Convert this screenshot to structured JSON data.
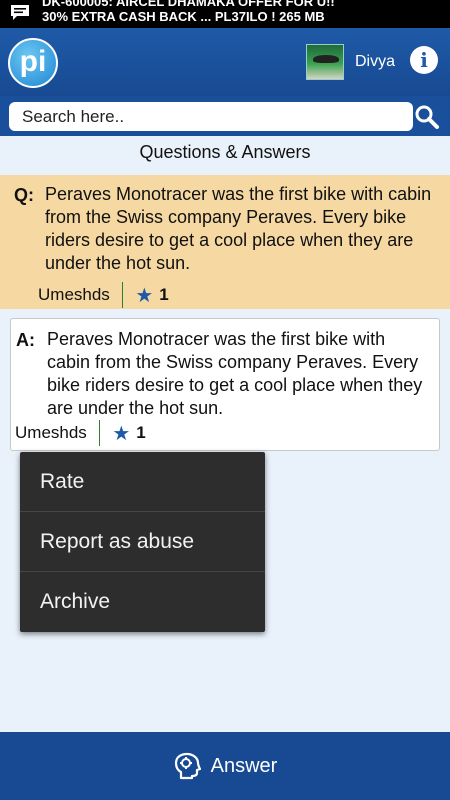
{
  "status_bar": {
    "ticker_line1": "DK-600005: AIRCEL DHAMAKA OFFER FOR U!!",
    "ticker_line2": "30% EXTRA CASH BACK ... PL37ILO ! 265 MB"
  },
  "header": {
    "logo_text": "pi",
    "username": "Divya",
    "info_glyph": "i"
  },
  "search": {
    "placeholder": "Search here.."
  },
  "section_title": "Questions & Answers",
  "question": {
    "prefix": "Q:",
    "text": "Peraves Monotracer was the first bike with cabin from the Swiss company Peraves. Every bike riders desire to get a cool place when they are under the hot sun.",
    "author": "Umeshds",
    "rating": "1"
  },
  "answer": {
    "prefix": "A:",
    "text": "Peraves Monotracer was the first bike with cabin from the Swiss company Peraves. Every bike riders desire to get a cool place when they are under the hot sun.",
    "author": "Umeshds",
    "rating": "1"
  },
  "context_menu": {
    "items": [
      "Rate",
      "Report as abuse",
      "Archive"
    ]
  },
  "bottom_bar": {
    "answer_label": "Answer"
  },
  "icons": {
    "message": "message-icon",
    "search": "search-icon",
    "info": "info-icon",
    "star": "star-icon",
    "answer": "head-icon"
  },
  "colors": {
    "primary": "#1f5aa8",
    "question_bg": "#f6d8a2",
    "menu_bg": "#2d2d2d",
    "page_bg": "#e9f2fb"
  }
}
